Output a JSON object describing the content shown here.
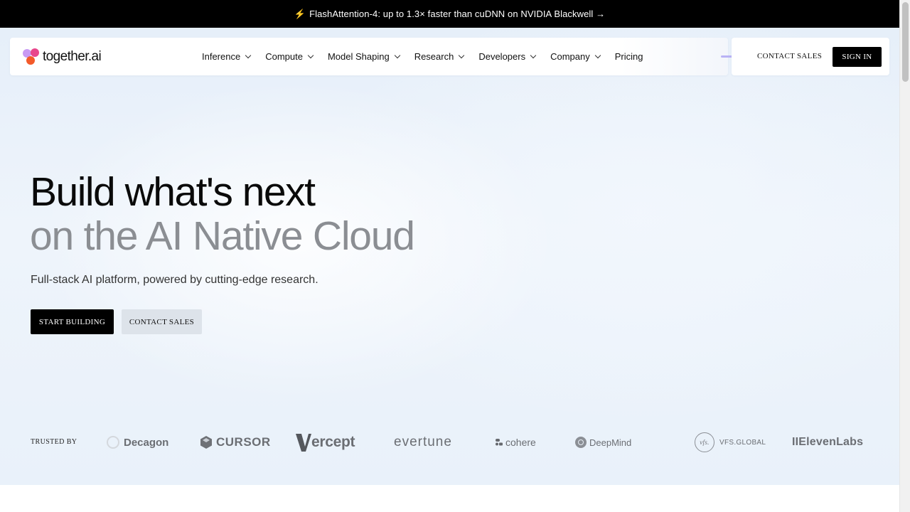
{
  "banner": {
    "icon": "lightning-icon",
    "text": "FlashAttention-4: up to 1.3× faster than cuDNN on NVIDIA Blackwell →"
  },
  "nav": {
    "logo_text": "together.ai",
    "items": [
      {
        "label": "Inference",
        "dropdown": true
      },
      {
        "label": "Compute",
        "dropdown": true
      },
      {
        "label": "Model Shaping",
        "dropdown": true
      },
      {
        "label": "Research",
        "dropdown": true
      },
      {
        "label": "Developers",
        "dropdown": true
      },
      {
        "label": "Company",
        "dropdown": true
      },
      {
        "label": "Pricing",
        "dropdown": false
      }
    ],
    "contact_sales": "CONTACT SALES",
    "sign_in": "SIGN IN"
  },
  "hero": {
    "headline": "Build what's next",
    "headline_muted": "on the AI Native Cloud",
    "subtitle": "Full-stack AI platform, powered by cutting-edge research.",
    "primary_cta": "START BUILDING",
    "secondary_cta": "CONTACT SALES"
  },
  "trusted": {
    "label": "TRUSTED BY",
    "logos": [
      "Decagon",
      "CURSOR",
      "ercept",
      "evertune",
      "cohere",
      "DeepMind",
      "VFS.GLOBAL",
      "IIElevenLabs"
    ],
    "vfs_mark": "vfs."
  },
  "colors": {
    "accent": "#000000",
    "muted_heading": "#8b8e93",
    "secondary_button": "#dde3ea"
  }
}
